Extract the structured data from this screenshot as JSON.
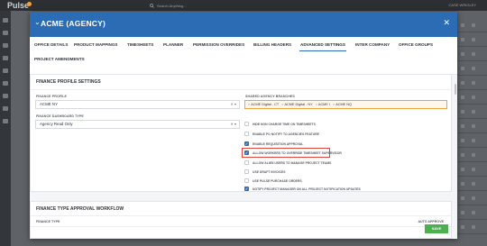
{
  "app": {
    "logo": "Pulse",
    "search_placeholder": "Search Anything...",
    "user": "CASE WRIGLEY"
  },
  "modal": {
    "title": "ACME (AGENCY)",
    "close_icon": "close-icon"
  },
  "tabs": [
    {
      "label": "OFFICE DETAILS"
    },
    {
      "label": "PRODUCT MAPPINGS"
    },
    {
      "label": "TIMESHEETS"
    },
    {
      "label": "PLANNER"
    },
    {
      "label": "PERMISSION OVERRIDES"
    },
    {
      "label": "BILLING HEADERS"
    },
    {
      "label": "ADVANCED SETTINGS",
      "active": true
    },
    {
      "label": "INTER COMPANY"
    },
    {
      "label": "OFFICE GROUPS"
    },
    {
      "label": "PROJECT AMENDMENTS"
    }
  ],
  "finance_profile": {
    "title": "FINANCE PROFILE SETTINGS",
    "profile_label": "FINANCE PROFILE",
    "profile_value": "ACME NY",
    "dashboard_label": "FINANCE DASHBOARD TYPE",
    "dashboard_value": "Agency Read Only",
    "shared_label": "SHARED AGENCY BRANCHES",
    "shared_tags": [
      "ACME Digital - CT",
      "ACME Digital - NY",
      "ACME I",
      "ACME NQ"
    ],
    "options": [
      {
        "label": "HIDE NON CHARGE TIME ON TIMESHEETS",
        "checked": false
      },
      {
        "label": "ENABLE PO NOTIFY TO AGENCIES FEATURE",
        "checked": false
      },
      {
        "label": "ENABLE REQUISITION APPROVAL",
        "checked": true
      },
      {
        "label": "ALLOW WORKERS TO OVERRIDE TIMESHEET SUPERVISOR",
        "checked": true
      },
      {
        "label": "ALLOW ALIEN USERS TO MANAGE PROJECT TEAMS",
        "checked": false
      },
      {
        "label": "USE DRAFT INVOICES",
        "checked": false
      },
      {
        "label": "USE PULSE PURCHASE ORDERS",
        "checked": false
      },
      {
        "label": "NOTIFY PROJECT MANAGER ON ALL PROJECT NOTIFICATION UPDATES",
        "checked": true
      }
    ]
  },
  "approval": {
    "title": "FINANCE TYPE APPROVAL WORKFLOW",
    "col_finance_type": "FINANCE TYPE",
    "col_auto_approve": "AUTO APPROVE"
  },
  "footer": {
    "save_label": "SAVE"
  },
  "colors": {
    "header": "#2b6cb4",
    "save": "#4caf50",
    "highlight": "#e0453b",
    "tag_border": "#f1a23a"
  }
}
